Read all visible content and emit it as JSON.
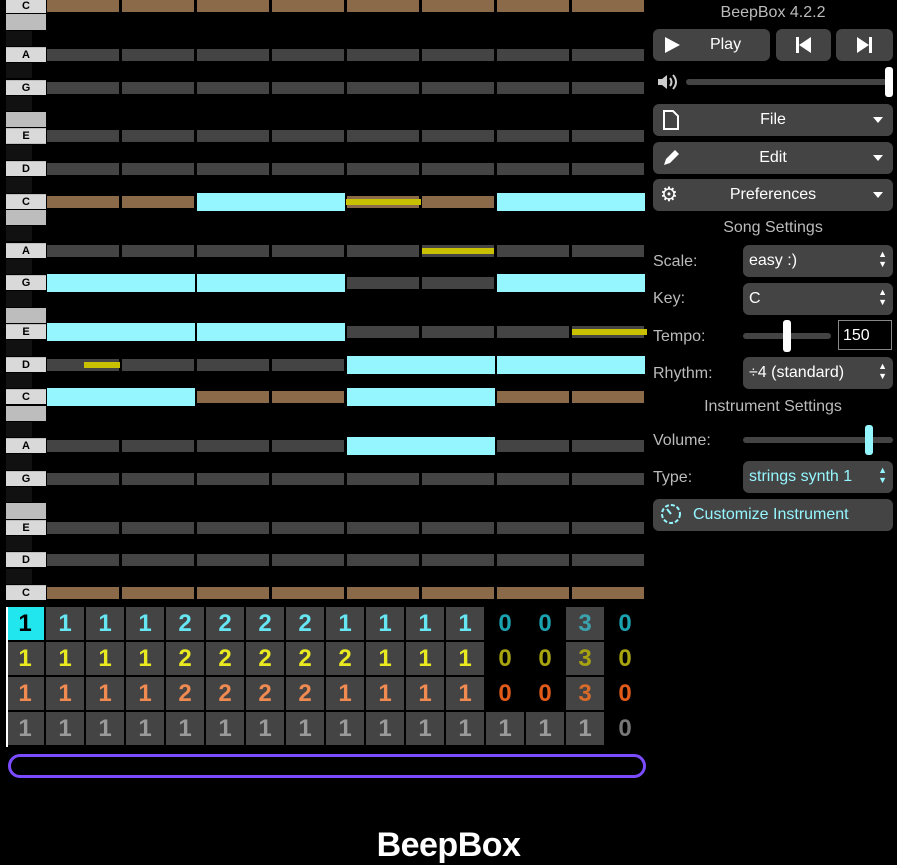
{
  "app": {
    "version_title": "BeepBox 4.2.2",
    "footer_logo": "BeepBox"
  },
  "transport": {
    "play_label": "Play"
  },
  "menus": {
    "file_label": "File",
    "edit_label": "Edit",
    "preferences_label": "Preferences"
  },
  "song_settings": {
    "heading": "Song Settings",
    "scale_label": "Scale:",
    "scale_value": "easy :)",
    "key_label": "Key:",
    "key_value": "C",
    "tempo_label": "Tempo:",
    "tempo_value": "150",
    "rhythm_label": "Rhythm:",
    "rhythm_value": "÷4 (standard)"
  },
  "instrument_settings": {
    "heading": "Instrument Settings",
    "volume_label": "Volume:",
    "type_label": "Type:",
    "type_value": "strings synth 1",
    "customize_label": "Customize Instrument"
  },
  "piano_labels": [
    "C",
    "A",
    "G",
    "E",
    "D",
    "C",
    "A",
    "G",
    "E",
    "D",
    "C",
    "A",
    "G",
    "E",
    "D",
    "C"
  ],
  "pattern_rows": [
    {
      "color": "#66e6f2",
      "values": [
        "1",
        "1",
        "1",
        "1",
        "2",
        "2",
        "2",
        "2",
        "1",
        "1",
        "1",
        "1",
        "0",
        "0",
        "3",
        "0"
      ]
    },
    {
      "color": "#eaea20",
      "values": [
        "1",
        "1",
        "1",
        "1",
        "2",
        "2",
        "2",
        "2",
        "2",
        "1",
        "1",
        "1",
        "0",
        "0",
        "3",
        "0"
      ]
    },
    {
      "color": "#ef8a50",
      "values": [
        "1",
        "1",
        "1",
        "1",
        "2",
        "2",
        "2",
        "2",
        "1",
        "1",
        "1",
        "1",
        "0",
        "0",
        "3",
        "0"
      ]
    },
    {
      "color": "#9a9a9a",
      "values": [
        "1",
        "1",
        "1",
        "1",
        "1",
        "1",
        "1",
        "1",
        "1",
        "1",
        "1",
        "1",
        "1",
        "1",
        "1",
        "0"
      ]
    }
  ],
  "colors": {
    "note": "#96f6ff",
    "other_channel_note": "#c8c000",
    "tonic_row": "#8a6a48",
    "row": "#444444",
    "accent": "#7a4bff",
    "selected_pattern": "#22e6ee"
  }
}
